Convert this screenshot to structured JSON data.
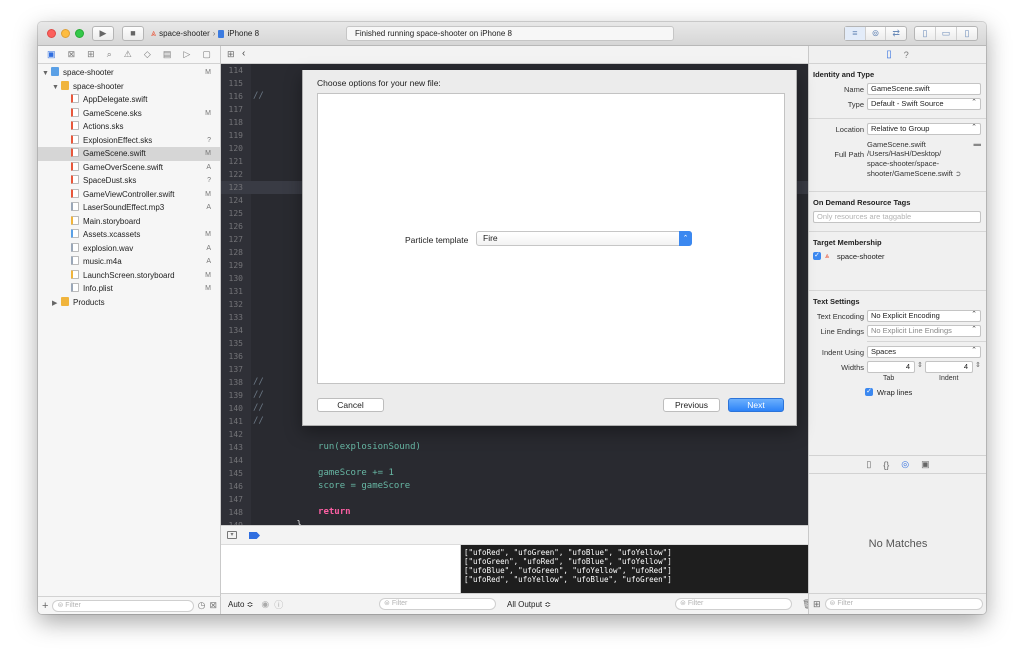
{
  "toolbar": {
    "scheme_name": "space-shooter",
    "device_name": "iPhone 8",
    "activity_text": "Finished running space-shooter on iPhone 8",
    "run_icon": "play-icon",
    "stop_icon": "stop-icon"
  },
  "navigator": {
    "project": {
      "name": "space-shooter",
      "status": "M"
    },
    "group": {
      "name": "space-shooter"
    },
    "files": [
      {
        "name": "AppDelegate.swift",
        "status": "",
        "icon": "swift-file-icon",
        "color": "#e8573b"
      },
      {
        "name": "GameScene.sks",
        "status": "M",
        "icon": "sks-file-icon",
        "color": "#e8573b"
      },
      {
        "name": "Actions.sks",
        "status": "",
        "icon": "sks-file-icon",
        "color": "#e8573b"
      },
      {
        "name": "ExplosionEffect.sks",
        "status": "?",
        "icon": "sks-file-icon",
        "color": "#e8573b"
      },
      {
        "name": "GameScene.swift",
        "status": "M",
        "icon": "swift-file-icon",
        "color": "#e8573b"
      },
      {
        "name": "GameOverScene.swift",
        "status": "A",
        "icon": "swift-file-icon",
        "color": "#e8573b"
      },
      {
        "name": "SpaceDust.sks",
        "status": "?",
        "icon": "sks-file-icon",
        "color": "#e8573b"
      },
      {
        "name": "GameViewController.swift",
        "status": "M",
        "icon": "swift-file-icon",
        "color": "#e8573b"
      },
      {
        "name": "LaserSoundEffect.mp3",
        "status": "A",
        "icon": "audio-file-icon",
        "color": "#9aa7b8"
      },
      {
        "name": "Main.storyboard",
        "status": "",
        "icon": "storyboard-file-icon",
        "color": "#f0b43c"
      },
      {
        "name": "Assets.xcassets",
        "status": "M",
        "icon": "assets-folder-icon",
        "color": "#5aa0e6"
      },
      {
        "name": "explosion.wav",
        "status": "A",
        "icon": "audio-file-icon",
        "color": "#9aa7b8"
      },
      {
        "name": "music.m4a",
        "status": "A",
        "icon": "audio-file-icon",
        "color": "#9aa7b8"
      },
      {
        "name": "LaunchScreen.storyboard",
        "status": "M",
        "icon": "storyboard-file-icon",
        "color": "#f0b43c"
      },
      {
        "name": "Info.plist",
        "status": "M",
        "icon": "plist-file-icon",
        "color": "#9aa7b8"
      }
    ],
    "products": {
      "name": "Products"
    },
    "filter_placeholder": "Filter"
  },
  "editor": {
    "lines": [
      {
        "n": "114",
        "code": ""
      },
      {
        "n": "115",
        "code": ""
      },
      {
        "n": "116",
        "code": "//"
      },
      {
        "n": "117",
        "code": ""
      },
      {
        "n": "118",
        "code": ""
      },
      {
        "n": "119",
        "code": ""
      },
      {
        "n": "120",
        "code": ""
      },
      {
        "n": "121",
        "code": ""
      },
      {
        "n": "122",
        "code": ""
      },
      {
        "n": "123",
        "code": ""
      },
      {
        "n": "124",
        "code": ""
      },
      {
        "n": "125",
        "code": ""
      },
      {
        "n": "126",
        "code": ""
      },
      {
        "n": "127",
        "code": ""
      },
      {
        "n": "128",
        "code": ""
      },
      {
        "n": "129",
        "code": ""
      },
      {
        "n": "130",
        "code": ""
      },
      {
        "n": "131",
        "code": ""
      },
      {
        "n": "132",
        "code": ""
      },
      {
        "n": "133",
        "code": ""
      },
      {
        "n": "134",
        "code": ""
      },
      {
        "n": "135",
        "code": ""
      },
      {
        "n": "136",
        "code": ""
      },
      {
        "n": "137",
        "code": ""
      },
      {
        "n": "138",
        "code": "//"
      },
      {
        "n": "139",
        "code": "//"
      },
      {
        "n": "140",
        "code": "//"
      },
      {
        "n": "141",
        "code": "//            }"
      },
      {
        "n": "142",
        "code": ""
      },
      {
        "n": "143",
        "code": "            run(explosionSound)"
      },
      {
        "n": "144",
        "code": ""
      },
      {
        "n": "145",
        "code": "            gameScore += 1"
      },
      {
        "n": "146",
        "code": "            score = gameScore"
      },
      {
        "n": "147",
        "code": ""
      },
      {
        "n": "148",
        "code": "            return"
      },
      {
        "n": "149",
        "code": "        }"
      }
    ],
    "current_line": "123"
  },
  "debug": {
    "console_lines": [
      "[\"ufoRed\", \"ufoGreen\", \"ufoBlue\", \"ufoYellow\"]",
      "[\"ufoGreen\", \"ufoRed\", \"ufoBlue\", \"ufoYellow\"]",
      "[\"ufoBlue\", \"ufoGreen\", \"ufoYellow\", \"ufoRed\"]",
      "[\"ufoRed\", \"ufoYellow\", \"ufoBlue\", \"ufoGreen\"]"
    ],
    "auto_label": "Auto ≎",
    "filter_placeholder": "Filter",
    "output_label": "All Output ≎"
  },
  "sheet": {
    "title": "Choose options for your new file:",
    "template_label": "Particle template",
    "template_value": "Fire",
    "cancel_label": "Cancel",
    "previous_label": "Previous",
    "next_label": "Next"
  },
  "inspector": {
    "identity_title": "Identity and Type",
    "name_label": "Name",
    "name_value": "GameScene.swift",
    "type_label": "Type",
    "type_value": "Default - Swift Source",
    "location_label": "Location",
    "location_value": "Relative to Group",
    "location_file": "GameScene.swift",
    "fullpath_label": "Full Path",
    "fullpath_lines": [
      "/Users/HasH/Desktop/",
      "space-shooter/space-",
      "shooter/GameScene.swift"
    ],
    "odr_title": "On Demand Resource Tags",
    "odr_placeholder": "Only resources are taggable",
    "target_title": "Target Membership",
    "target_name": "space-shooter",
    "text_settings_title": "Text Settings",
    "encoding_label": "Text Encoding",
    "encoding_value": "No Explicit Encoding",
    "endings_label": "Line Endings",
    "endings_value": "No Explicit Line Endings",
    "indent_label": "Indent Using",
    "indent_value": "Spaces",
    "widths_label": "Widths",
    "tab_value": "4",
    "indent_width_value": "4",
    "tab_caption": "Tab",
    "indent_caption": "Indent",
    "wrap_label": "Wrap lines",
    "no_matches": "No Matches",
    "filter_placeholder": "Filter"
  }
}
